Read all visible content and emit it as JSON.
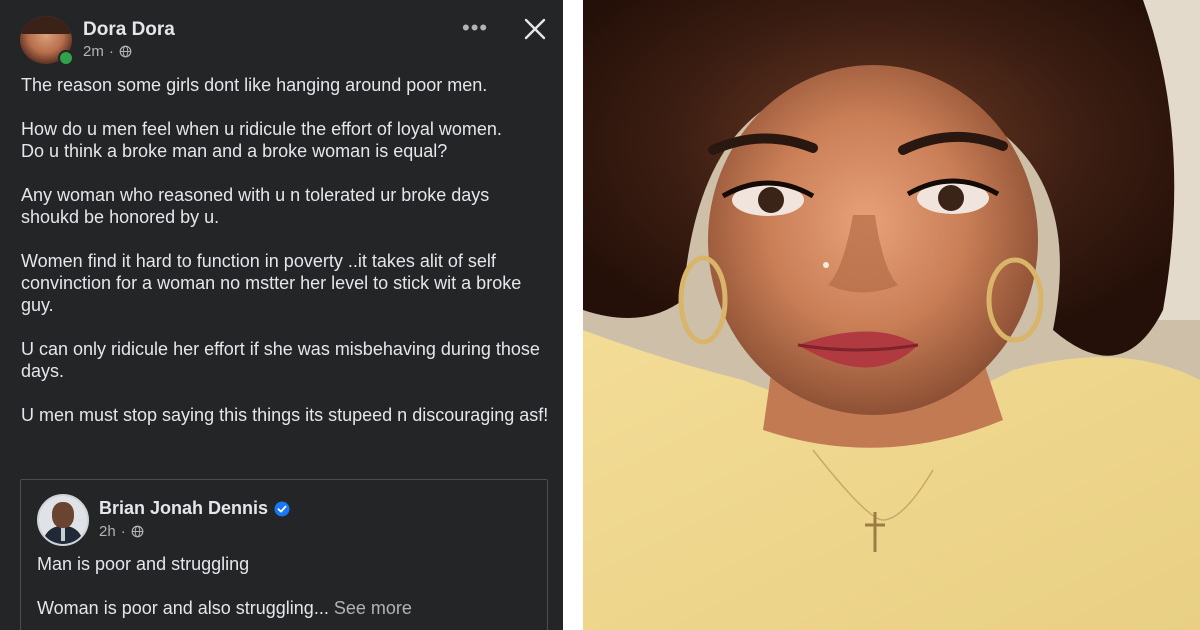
{
  "post": {
    "author": "Dora Dora",
    "time": "2m",
    "more_label": "•••",
    "paragraphs": [
      "The reason some girls dont like hanging around poor men.",
      "How do u men feel when u ridicule the effort of loyal women.\nDo u think a broke man and a broke woman is equal?",
      "Any woman who reasoned with u n tolerated ur broke days shoukd be honored by u.",
      "Women find it hard to function in poverty ..it takes alit of self convinction for a woman no mstter her level to stick wit a broke guy.",
      "U can only ridicule her effort if she was misbehaving during those days.",
      "U men must stop saying this things its stupeed n discouraging asf!"
    ]
  },
  "shared": {
    "author": "Brian Jonah Dennis",
    "time": "2h",
    "line1": "Man is poor and struggling",
    "line2": "Woman is poor and also struggling...",
    "see_more": "See more"
  },
  "colors": {
    "panel_bg": "#242526",
    "text_primary": "#e4e6eb",
    "text_secondary": "#b0b3b8",
    "online_green": "#31a24c",
    "verified_blue": "#1877f2"
  },
  "icons": [
    "globe-icon",
    "more-icon",
    "close-icon",
    "verified-icon"
  ]
}
